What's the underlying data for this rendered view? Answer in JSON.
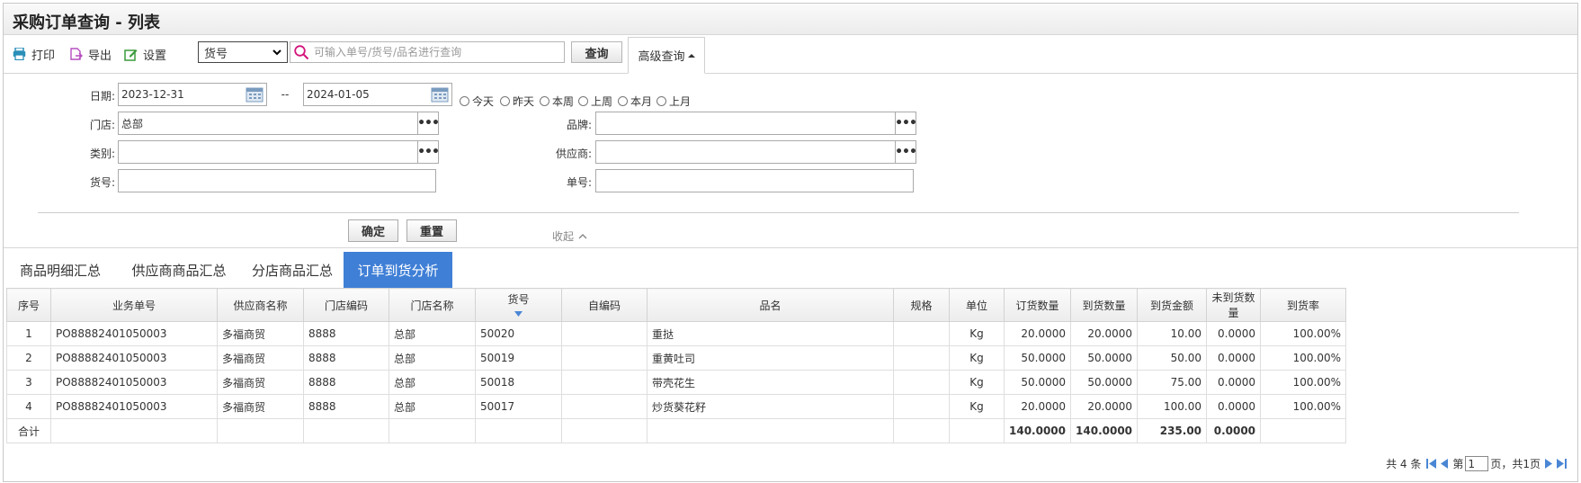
{
  "title": "采购订单查询 - 列表",
  "toolbar": {
    "print": "打印",
    "export": "导出",
    "settings": "设置",
    "search_field": "货号",
    "search_placeholder": "可输入单号/货号/品名进行查询",
    "query": "查询",
    "advanced": "高级查询"
  },
  "filters": {
    "date_label": "日期:",
    "date_from": "2023-12-31",
    "date_sep": "--",
    "date_to": "2024-01-05",
    "quick": [
      "今天",
      "昨天",
      "本周",
      "上周",
      "本月",
      "上月"
    ],
    "store_label": "门店:",
    "store_value": "总部",
    "brand_label": "品牌:",
    "category_label": "类别:",
    "supplier_label": "供应商:",
    "item_no_label": "货号:",
    "order_no_label": "单号:",
    "confirm": "确定",
    "reset": "重置",
    "collapse": "收起"
  },
  "tabs": [
    "商品明细汇总",
    "供应商商品汇总",
    "分店商品汇总",
    "订单到货分析"
  ],
  "active_tab": 3,
  "table": {
    "headers": [
      "序号",
      "业务单号",
      "供应商名称",
      "门店编码",
      "门店名称",
      "货号",
      "自编码",
      "品名",
      "规格",
      "单位",
      "订货数量",
      "到货数量",
      "到货金额",
      "未到货数量",
      "到货率"
    ],
    "rows": [
      [
        "1",
        "PO88882401050003",
        "多福商贸",
        "8888",
        "总部",
        "50020",
        "",
        "重挞",
        "",
        "Kg",
        "20.0000",
        "20.0000",
        "10.00",
        "0.0000",
        "100.00%"
      ],
      [
        "2",
        "PO88882401050003",
        "多福商贸",
        "8888",
        "总部",
        "50019",
        "",
        "重黄吐司",
        "",
        "Kg",
        "50.0000",
        "50.0000",
        "50.00",
        "0.0000",
        "100.00%"
      ],
      [
        "3",
        "PO88882401050003",
        "多福商贸",
        "8888",
        "总部",
        "50018",
        "",
        "带壳花生",
        "",
        "Kg",
        "50.0000",
        "50.0000",
        "75.00",
        "0.0000",
        "100.00%"
      ],
      [
        "4",
        "PO88882401050003",
        "多福商贸",
        "8888",
        "总部",
        "50017",
        "",
        "炒货葵花籽",
        "",
        "Kg",
        "20.0000",
        "20.0000",
        "100.00",
        "0.0000",
        "100.00%"
      ]
    ],
    "total_label": "合计",
    "totals": {
      "order_qty": "140.0000",
      "arrived_qty": "140.0000",
      "arrived_amount": "235.00",
      "unarrived_qty": "0.0000"
    }
  },
  "pager": {
    "total": "共 4 条",
    "page_prefix": "第",
    "page": "1",
    "page_suffix": "页，共1页"
  },
  "colors": {
    "accent": "#3f7fd6"
  }
}
